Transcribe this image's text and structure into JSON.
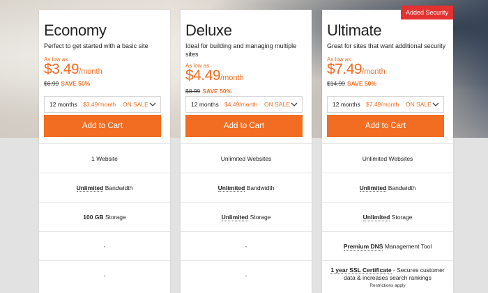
{
  "plans": [
    {
      "name": "Economy",
      "description": "Perfect to get started with a basic site",
      "low_as": "As low as",
      "price": "$3.49",
      "per": "/month",
      "old_price": "$6.99",
      "save": "SAVE 50%",
      "select": {
        "term": "12 months",
        "price": "$3.49/month",
        "status": "ON SALE"
      },
      "cta": "Add to Cart",
      "features": [
        {
          "bold": "",
          "text": "1 Website"
        },
        {
          "bold": "Unlimited",
          "text": " Bandwidth"
        },
        {
          "bold": "100 GB",
          "text": " Storage"
        },
        {
          "bold": "",
          "text": "-"
        },
        {
          "bold": "",
          "text": "-"
        }
      ]
    },
    {
      "name": "Deluxe",
      "description": "Ideal for building and managing multiple sites",
      "low_as": "As low as",
      "price": "$4.49",
      "per": "/month",
      "old_price": "$8.99",
      "save": "SAVE 50%",
      "select": {
        "term": "12 months",
        "price": "$4.49/month",
        "status": "ON SALE"
      },
      "cta": "Add to Cart",
      "features": [
        {
          "bold": "",
          "text": "Unlimited Websites"
        },
        {
          "bold": "Unlimited",
          "text": " Bandwidth"
        },
        {
          "bold": "Unlimited",
          "text": " Storage"
        },
        {
          "bold": "",
          "text": "-"
        },
        {
          "bold": "",
          "text": "-"
        }
      ]
    },
    {
      "name": "Ultimate",
      "badge": "Added Security",
      "description": "Great for sites that want additional security",
      "low_as": "As low as",
      "price": "$7.49",
      "per": "/month",
      "old_price": "$14.99",
      "save": "SAVE 50%",
      "select": {
        "term": "12 months",
        "price": "$7.49/month",
        "status": "ON SALE"
      },
      "cta": "Add to Cart",
      "features": [
        {
          "bold": "",
          "text": "Unlimited Websites"
        },
        {
          "bold": "Unlimited",
          "text": " Bandwidth"
        },
        {
          "bold": "Unlimited",
          "text": " Storage"
        },
        {
          "bold": "Premium DNS",
          "text": " Management Tool"
        },
        {
          "bold": "1 year SSL Certificate",
          "text": " - Secures customer data & increases search rankings",
          "note": "Restrictions apply"
        }
      ]
    }
  ],
  "colors": {
    "accent": "#f26d21",
    "badge": "#e3322f"
  },
  "icons": {
    "select_chevron": "chevron-down-icon"
  }
}
